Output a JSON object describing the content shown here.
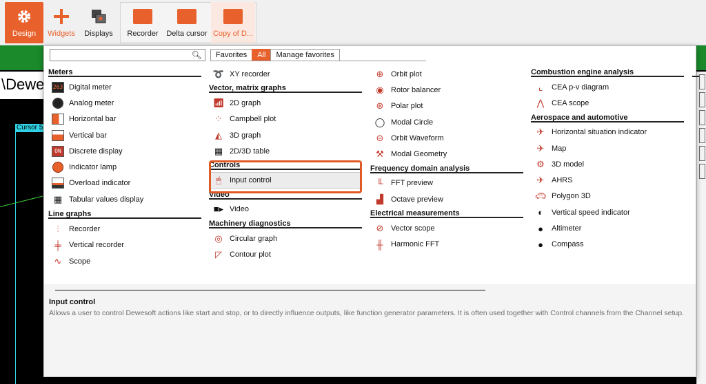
{
  "toolbar": {
    "design": "Design",
    "widgets": "Widgets",
    "displays": "Displays",
    "recorder": "Recorder",
    "delta_cursor": "Delta cursor",
    "copy": "Copy of D..."
  },
  "background": {
    "title_fragment": "\\Dewe",
    "cursor_tag": "Cursor 5"
  },
  "search": {
    "value": "",
    "placeholder": ""
  },
  "tabs": [
    "Favorites",
    "All",
    "Manage favorites"
  ],
  "columns": {
    "c1": [
      {
        "section": "Meters",
        "items": [
          "Digital meter",
          "Analog meter",
          "Horizontal bar",
          "Vertical bar",
          "Discrete display",
          "Indicator lamp",
          "Overload indicator",
          "Tabular values display"
        ]
      },
      {
        "section": "Line graphs",
        "items": [
          "Recorder",
          "Vertical recorder",
          "Scope"
        ]
      }
    ],
    "c2": [
      {
        "section": "",
        "items": [
          "XY recorder"
        ]
      },
      {
        "section": "Vector, matrix graphs",
        "items": [
          "2D graph",
          "Campbell plot",
          "3D graph",
          "2D/3D table"
        ]
      },
      {
        "section": "Controls",
        "items": [
          "Input control"
        ]
      },
      {
        "section": "Video",
        "items": [
          "Video"
        ]
      },
      {
        "section": "Machinery diagnostics",
        "items": [
          "Circular graph",
          "Contour plot"
        ]
      }
    ],
    "c3": [
      {
        "section": "",
        "items": [
          "Orbit plot",
          "Rotor balancer",
          "Polar plot",
          "Modal Circle",
          "Orbit Waveform",
          "Modal Geometry"
        ]
      },
      {
        "section": "Frequency domain analysis",
        "items": [
          "FFT preview",
          "Octave preview"
        ]
      },
      {
        "section": "Electrical measurements",
        "items": [
          "Vector scope",
          "Harmonic FFT"
        ]
      }
    ],
    "c4": [
      {
        "section": "Combustion engine analysis",
        "items": [
          "CEA p-v diagram",
          "CEA scope"
        ]
      },
      {
        "section": "Aerospace and automotive",
        "items": [
          "Horizontal situation indicator",
          "Map",
          "3D model",
          "AHRS",
          "Polygon 3D",
          "Vertical speed indicator",
          "Altimeter",
          "Compass"
        ]
      }
    ]
  },
  "description": {
    "title": "Input control",
    "text": "Allows a user to control Dewesoft actions like start and stop, or to directly influence outputs, like function generator parameters. It is often used together with Control channels from the Channel setup."
  },
  "colors": {
    "accent": "#e8612c",
    "green": "#1a8a2a",
    "cyan": "#2fd3e6"
  }
}
